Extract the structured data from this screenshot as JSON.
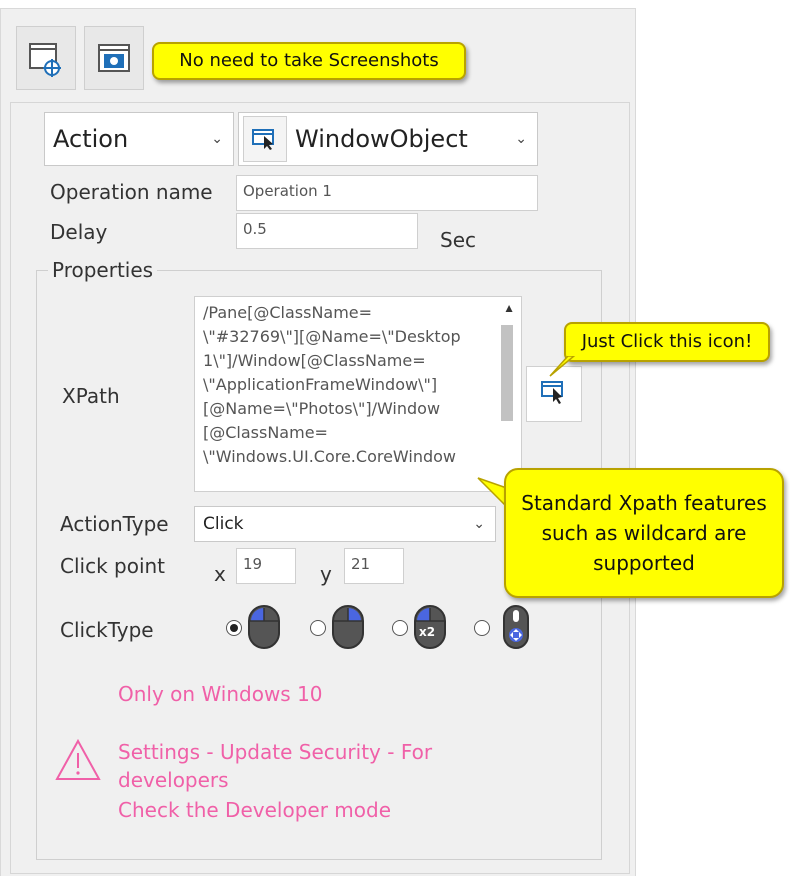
{
  "toolbar": {
    "capture_icon": "window-target-icon",
    "screenshot_icon": "camera-icon",
    "callout_text": "No need to take Screenshots"
  },
  "selectors": {
    "action_value": "Action",
    "object_value": "WindowObject",
    "object_icon": "window-pointer-icon"
  },
  "fields": {
    "operation_label": "Operation name",
    "operation_value": "Operation 1",
    "delay_label": "Delay",
    "delay_value": "0.5",
    "delay_unit": "Sec"
  },
  "properties": {
    "legend": "Properties",
    "xpath_label": "XPath",
    "xpath_lines": [
      "/Pane[@ClassName=",
      "\\\"#32769\\\"][@Name=\\\"Desktop",
      "1\\\"]/Window[@ClassName=",
      "\\\"ApplicationFrameWindow\\\"]",
      "[@Name=\\\"Photos\\\"]/Window",
      "[@ClassName=",
      "\\\"Windows.UI.Core.CoreWindow"
    ],
    "action_type_label": "ActionType",
    "action_type_value": "Click",
    "click_point_label": "Click point",
    "x_label": "x",
    "x_value": "19",
    "y_label": "y",
    "y_value": "21",
    "click_type_label": "ClickType",
    "click_type_selected": 0,
    "click_type_options": [
      "left-click-mouse-icon",
      "right-click-mouse-icon",
      "double-click-mouse-icon",
      "middle-click-mouse-icon"
    ],
    "double_click_badge": "x2"
  },
  "callouts": {
    "click_icon": "Just Click this icon!",
    "xpath_line1": "Standard Xpath features",
    "xpath_line2": "such as wildcard are",
    "xpath_line3": "supported"
  },
  "notice": {
    "windows_only": "Only on Windows 10",
    "warning_line1": "Settings - Update  Security - For",
    "warning_line2": "developers",
    "warning_line3": "Check the Developer mode",
    "warning_icon": "warning-triangle-icon"
  },
  "colors": {
    "callout_yellow": "#ffff00",
    "notice_pink": "#f060a8",
    "accent_blue": "#1f6fb8",
    "mouse_button_blue": "#4a66e0"
  }
}
